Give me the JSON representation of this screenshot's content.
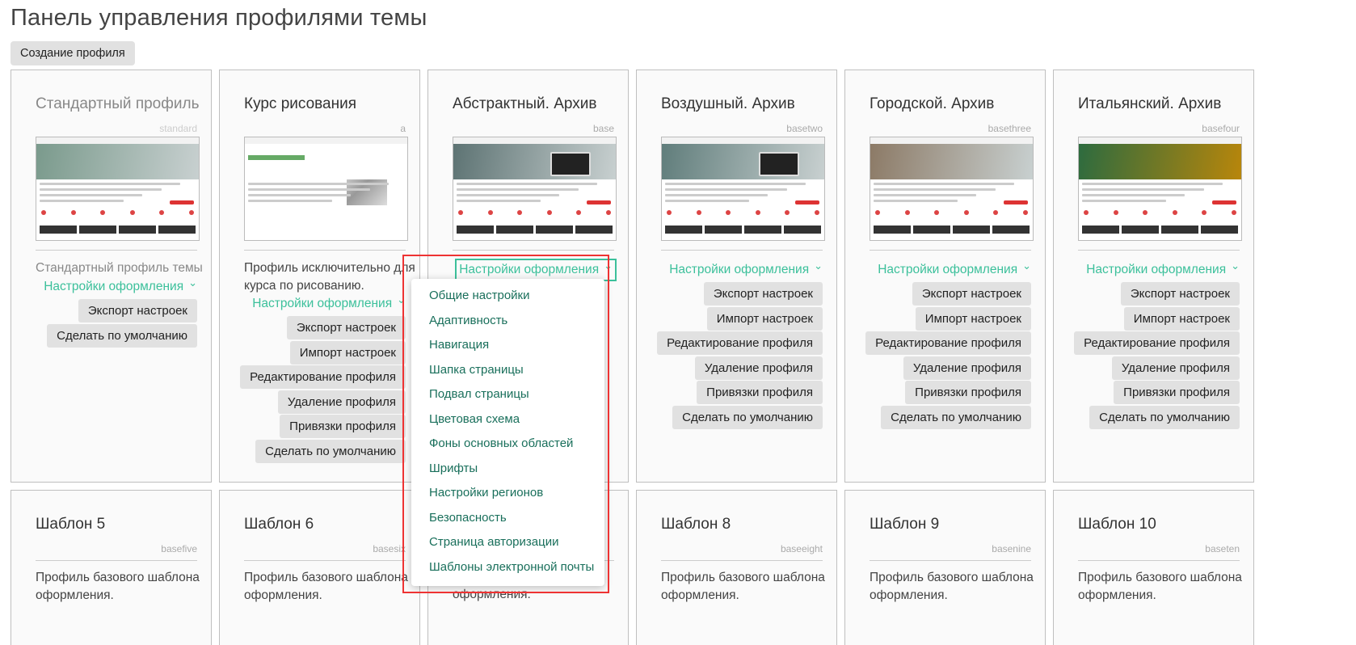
{
  "page": {
    "title": "Панель управления профилями темы",
    "create_button": "Создание профиля"
  },
  "colors": {
    "accent": "#3cc09b",
    "dropdown_text": "#196f5b",
    "highlight": "#e33333",
    "button_bg": "#e1e1e1"
  },
  "profiles": [
    {
      "title": "Стандартный профиль",
      "code": "standard",
      "description": "Стандартный профиль темы",
      "settings_label": "Настройки оформления",
      "actions": [
        "Экспорт настроек",
        "Сделать по умолчанию"
      ]
    },
    {
      "title": "Курс рисования",
      "code": "a",
      "description": "Профиль исключительно для курса по рисованию.",
      "settings_label": "Настройки оформления",
      "actions": [
        "Экспорт настроек",
        "Импорт настроек",
        "Редактирование профиля",
        "Удаление профиля",
        "Привязки профиля",
        "Сделать по умолчанию"
      ]
    },
    {
      "title": "Абстрактный. Архив",
      "code": "base",
      "description": "",
      "settings_label": "Настройки оформления",
      "actions": []
    },
    {
      "title": "Воздушный. Архив",
      "code": "basetwo",
      "description": "",
      "settings_label": "Настройки оформления",
      "actions": [
        "Экспорт настроек",
        "Импорт настроек",
        "Редактирование профиля",
        "Удаление профиля",
        "Привязки профиля",
        "Сделать по умолчанию"
      ]
    },
    {
      "title": "Городской. Архив",
      "code": "basethree",
      "description": "",
      "settings_label": "Настройки оформления",
      "actions": [
        "Экспорт настроек",
        "Импорт настроек",
        "Редактирование профиля",
        "Удаление профиля",
        "Привязки профиля",
        "Сделать по умолчанию"
      ]
    },
    {
      "title": "Итальянский. Архив",
      "code": "basefour",
      "description": "",
      "settings_label": "Настройки оформления",
      "actions": [
        "Экспорт настроек",
        "Импорт настроек",
        "Редактирование профиля",
        "Удаление профиля",
        "Привязки профиля",
        "Сделать по умолчанию"
      ]
    }
  ],
  "templates": [
    {
      "title": "Шаблон 5",
      "code": "basefive",
      "description": "Профиль базового шаблона оформления."
    },
    {
      "title": "Шаблон 6",
      "code": "basesix",
      "description": "Профиль базового шаблона оформления."
    },
    {
      "title": "",
      "code": "",
      "description": "оформления."
    },
    {
      "title": "Шаблон 8",
      "code": "baseeight",
      "description": "Профиль базового шаблона оформления."
    },
    {
      "title": "Шаблон 9",
      "code": "basenine",
      "description": "Профиль базового шаблона оформления."
    },
    {
      "title": "Шаблон 10",
      "code": "baseten",
      "description": "Профиль базового шаблона оформления."
    }
  ],
  "dropdown": {
    "items": [
      "Общие настройки",
      "Адаптивность",
      "Навигация",
      "Шапка страницы",
      "Подвал страницы",
      "Цветовая схема",
      "Фоны основных областей",
      "Шрифты",
      "Настройки регионов",
      "Безопасность",
      "Страница авторизации",
      "Шаблоны электронной почты"
    ]
  }
}
